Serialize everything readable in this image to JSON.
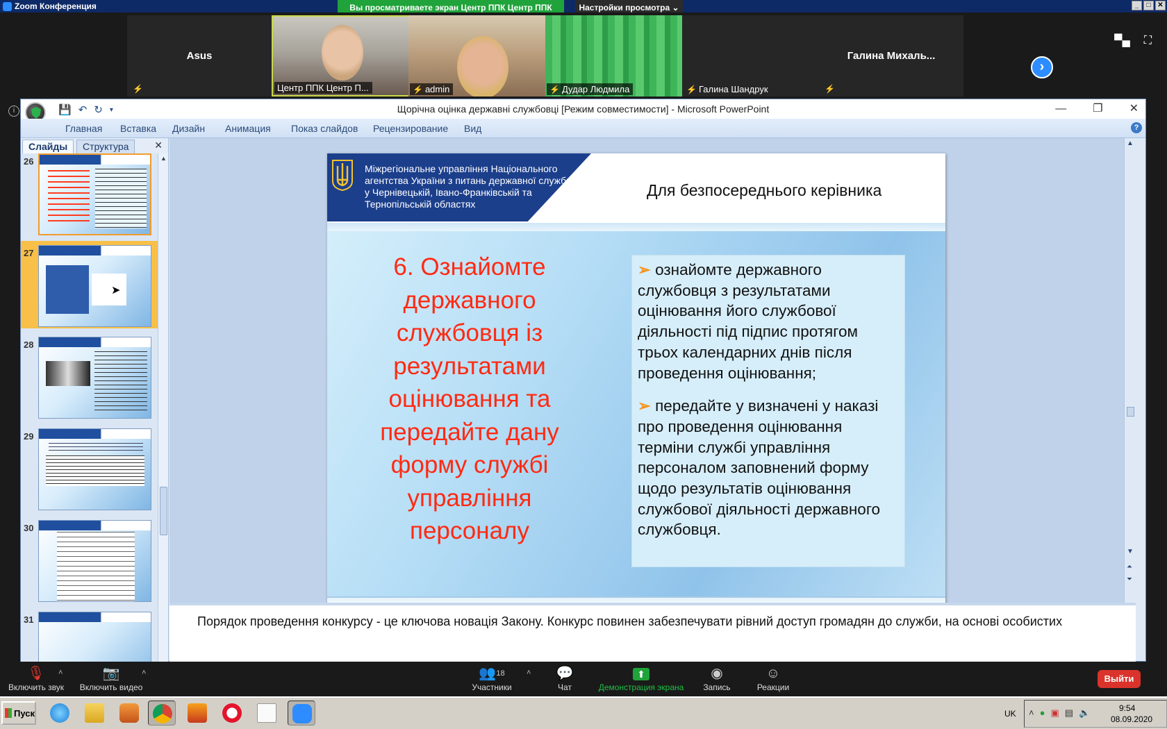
{
  "zoom": {
    "window_title": "Zoom Конференция",
    "share_banner": "Вы просматриваете экран Центр ППК Центр ППК",
    "view_options": "Настройки просмотра ⌄",
    "participants": [
      {
        "name": "Asus",
        "video": false
      },
      {
        "name": "Центр ППК Центр П...",
        "video": true
      },
      {
        "name": "admin",
        "video": true
      },
      {
        "name": "Дудар Людмила",
        "video": true
      },
      {
        "name": "Галина Шандрук",
        "video": false
      },
      {
        "name": "Галина  Михаль...",
        "video": false
      }
    ],
    "toolbar": {
      "mute": "Включить звук",
      "video": "Включить видео",
      "participants": "Участники",
      "participants_count": "18",
      "chat": "Чат",
      "share": "Демонстрация экрана",
      "record": "Запись",
      "reactions": "Реакции",
      "leave": "Выйти"
    }
  },
  "ppt": {
    "window_title": "Щорічна оцінка державні службовці [Режим совместимости] - Microsoft PowerPoint",
    "ribbon_tabs": [
      "Главная",
      "Вставка",
      "Дизайн",
      "Анимация",
      "Показ слайдов",
      "Рецензирование",
      "Вид"
    ],
    "panel_tabs": {
      "slides": "Слайды",
      "outline": "Структура"
    },
    "thumbnails": [
      {
        "number": "26"
      },
      {
        "number": "27"
      },
      {
        "number": "28"
      },
      {
        "number": "29"
      },
      {
        "number": "30"
      },
      {
        "number": "31"
      }
    ],
    "slide": {
      "agency": "Міжрегіональне управління Національного агентства України з питань державної служби  у Чернівецькій, Івано-Франківській та Тернопільській областях",
      "subtitle": "Для безпосереднього керівника",
      "title": "6. Ознайомте державного службовця  із результатами оцінювання  та передайте  дану форму  службі управління персоналу",
      "bullets": [
        "ознайомте державного службовця з результатами оцінювання його службової діяльності під підпис протягом трьох календарних днів після проведення оцінювання;",
        "передайте у визначені у наказі про проведення оцінювання  терміни службі управління персоналом заповнений форму щодо результатів оцінювання службової діяльності державного службовця."
      ]
    },
    "notes": "Порядок проведення конкурсу - це ключова новація Закону. Конкурс повинен забезпечувати рівний доступ громадян до служби, на основі особистих"
  },
  "taskbar": {
    "start": "Пуск",
    "language": "UK",
    "time": "9:54",
    "date": "08.09.2020"
  },
  "colors": {
    "zoom_blue": "#2d8cff",
    "share_green": "#1fa33a",
    "leave_red": "#d9332b",
    "slide_title_red": "#ff2a12",
    "agency_blue": "#1c3f8c",
    "bullet_orange": "#f7931e"
  }
}
